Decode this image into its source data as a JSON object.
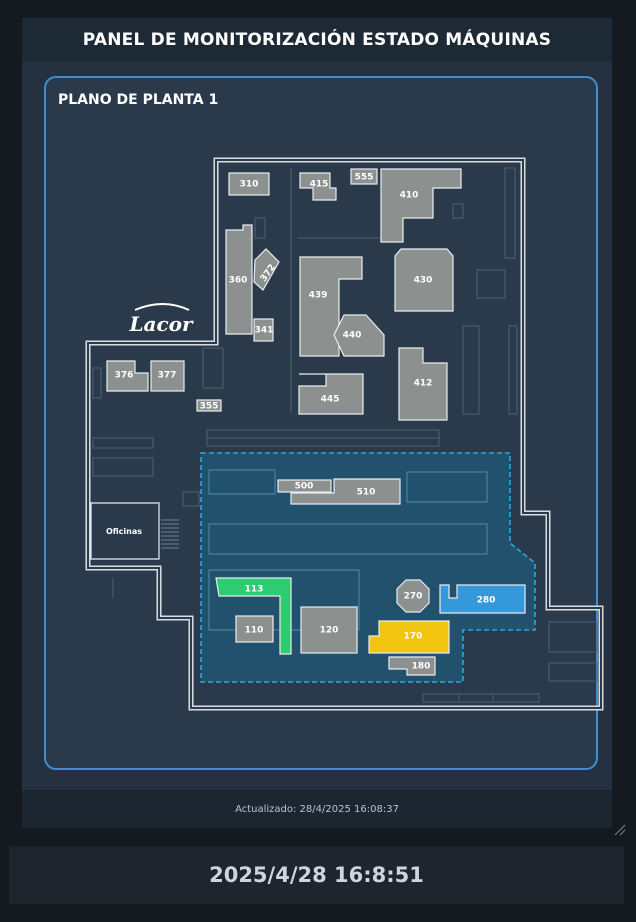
{
  "header": {
    "title": "PANEL DE MONITORIZACIÓN ESTADO MÁQUINAS"
  },
  "plan": {
    "title": "PLANO DE PLANTA 1",
    "logo_text": "Lacor",
    "office_label": "Oficinas"
  },
  "colors": {
    "idle": "#8c918f",
    "green": "#2ecc71",
    "blue": "#3498db",
    "yellow": "#f1c40f",
    "zone": "#1f5a78",
    "frame": "#3a8fd6"
  },
  "machines": [
    {
      "id": "310",
      "label": "310",
      "status": "idle"
    },
    {
      "id": "415",
      "label": "415",
      "status": "idle"
    },
    {
      "id": "555",
      "label": "555",
      "status": "idle"
    },
    {
      "id": "410",
      "label": "410",
      "status": "idle"
    },
    {
      "id": "360",
      "label": "360",
      "status": "idle"
    },
    {
      "id": "372",
      "label": "372",
      "status": "idle"
    },
    {
      "id": "341",
      "label": "341",
      "status": "idle"
    },
    {
      "id": "439",
      "label": "439",
      "status": "idle"
    },
    {
      "id": "430",
      "label": "430",
      "status": "idle"
    },
    {
      "id": "440",
      "label": "440",
      "status": "idle"
    },
    {
      "id": "376",
      "label": "376",
      "status": "idle"
    },
    {
      "id": "377",
      "label": "377",
      "status": "idle"
    },
    {
      "id": "355",
      "label": "355",
      "status": "idle"
    },
    {
      "id": "445",
      "label": "445",
      "status": "idle"
    },
    {
      "id": "412",
      "label": "412",
      "status": "idle"
    },
    {
      "id": "500",
      "label": "500",
      "status": "idle"
    },
    {
      "id": "510",
      "label": "510",
      "status": "idle"
    },
    {
      "id": "113",
      "label": "113",
      "status": "green"
    },
    {
      "id": "270",
      "label": "270",
      "status": "idle"
    },
    {
      "id": "280",
      "label": "280",
      "status": "blue"
    },
    {
      "id": "110",
      "label": "110",
      "status": "idle"
    },
    {
      "id": "120",
      "label": "120",
      "status": "idle"
    },
    {
      "id": "170",
      "label": "170",
      "status": "yellow"
    },
    {
      "id": "180",
      "label": "180",
      "status": "idle"
    }
  ],
  "footer": {
    "updated": "Actualizado: 28/4/2025 16:08:37"
  },
  "clock": {
    "time": "2025/4/28 16:8:51"
  }
}
